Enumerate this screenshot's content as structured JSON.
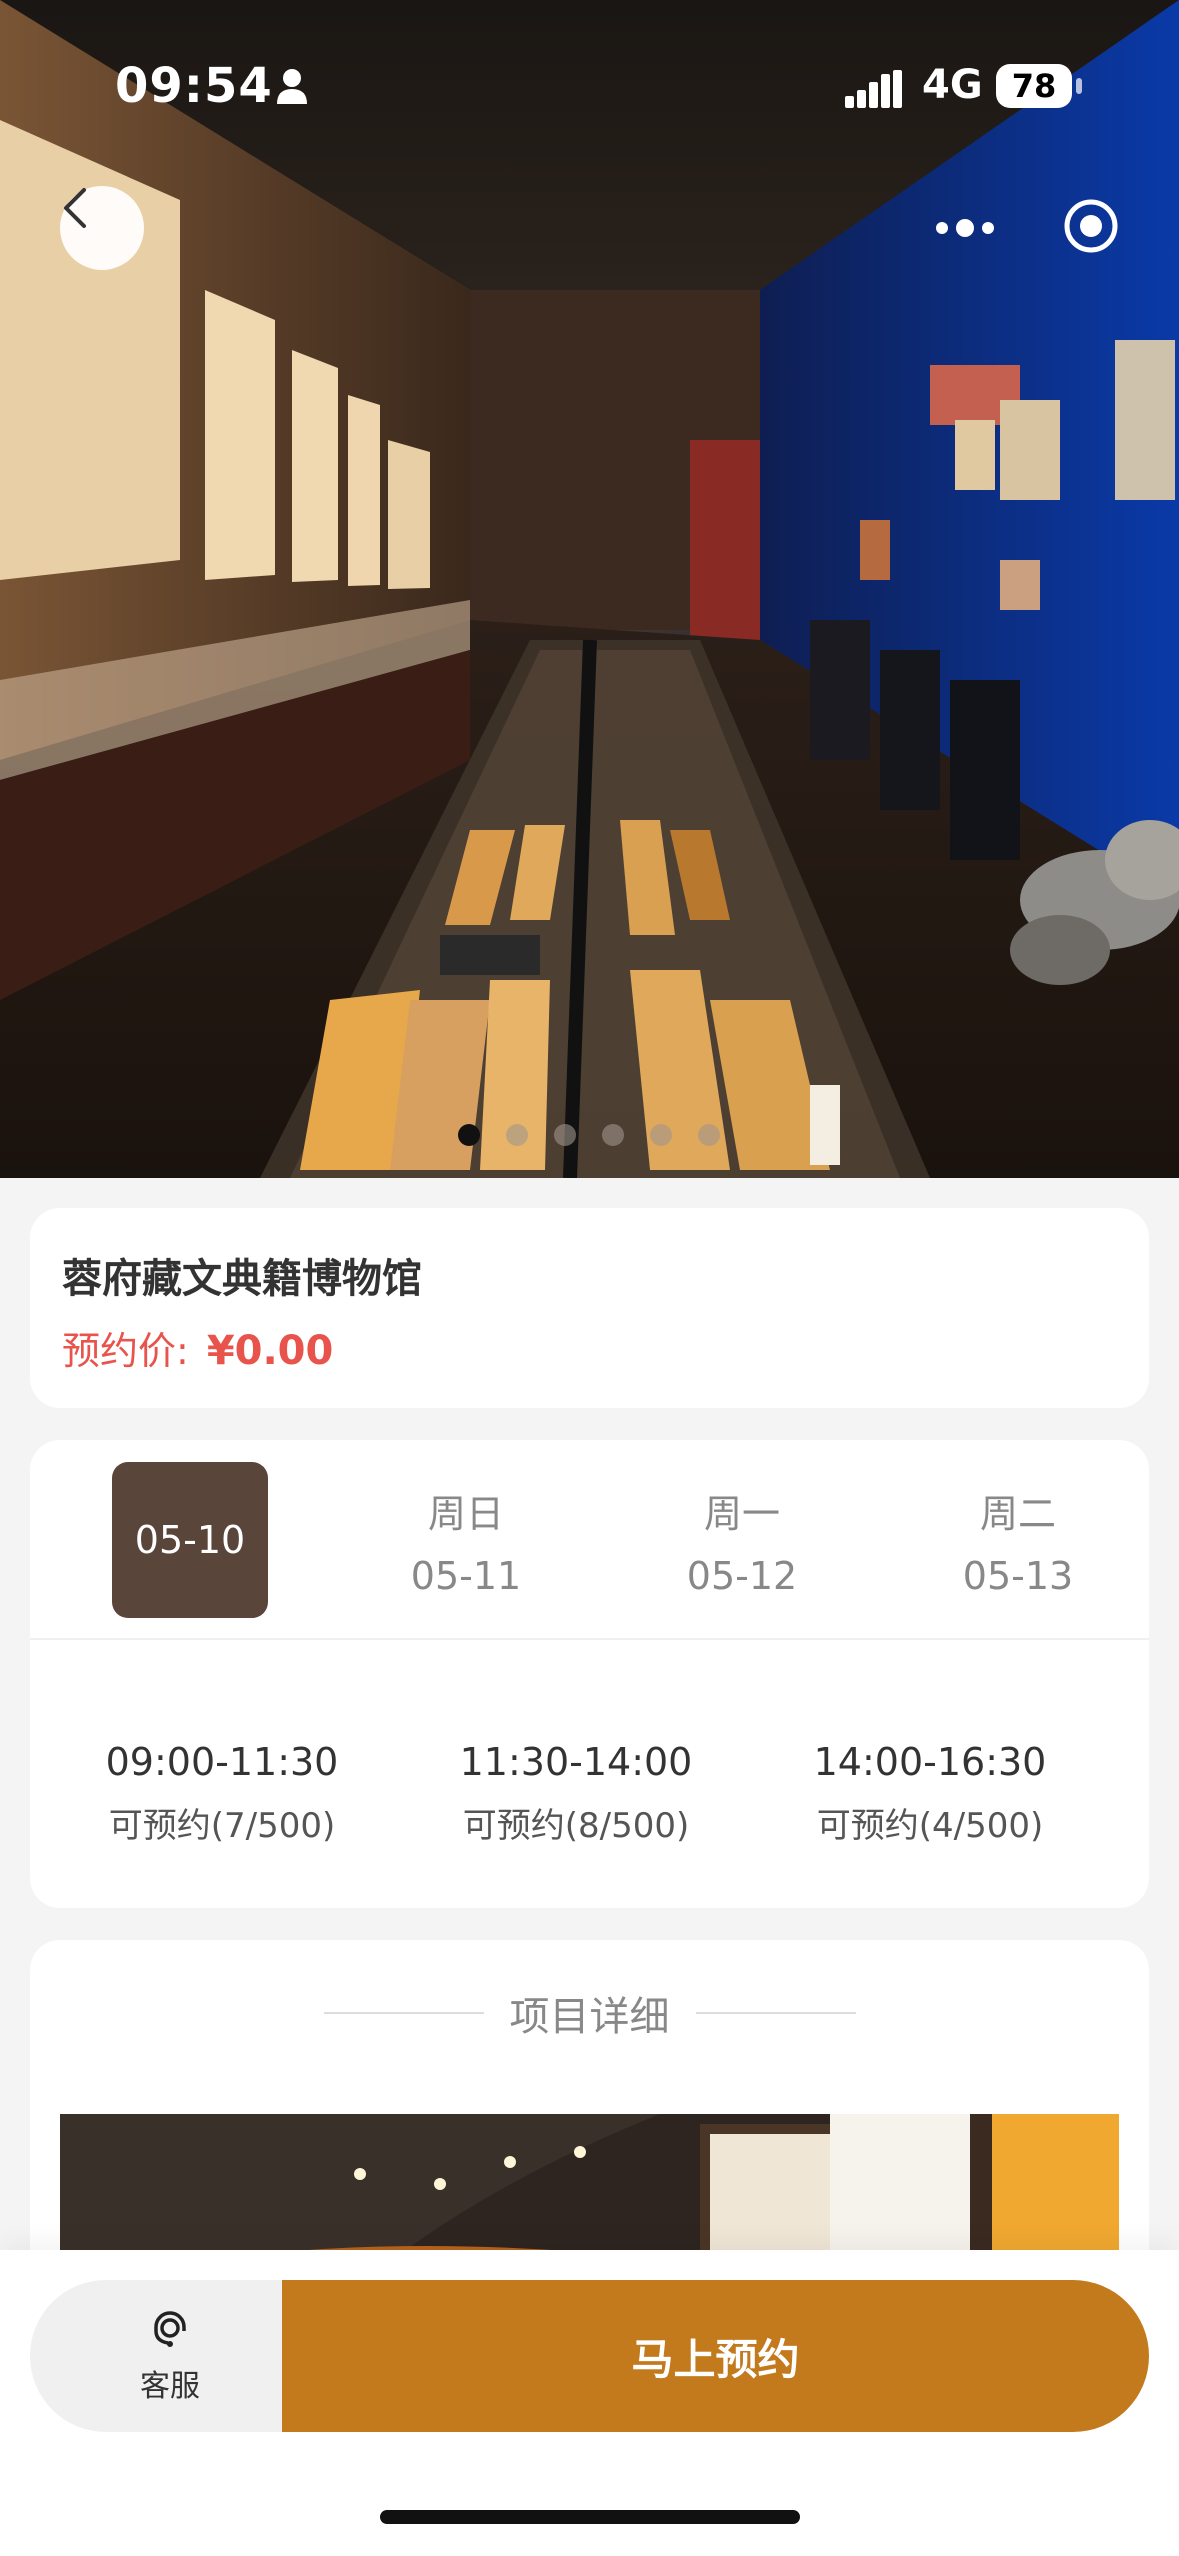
{
  "status_bar": {
    "time": "09:54",
    "network": "4G",
    "battery": "78"
  },
  "hero": {
    "slide_count": 6,
    "active_index": 0
  },
  "museum": {
    "name": "蓉府藏文典籍博物馆",
    "price_label": "预约价:",
    "price_value": "¥0.00"
  },
  "dates": [
    {
      "weekday": "",
      "date": "05-10",
      "selected": true
    },
    {
      "weekday": "周日",
      "date": "05-11",
      "selected": false
    },
    {
      "weekday": "周一",
      "date": "05-12",
      "selected": false
    },
    {
      "weekday": "周二",
      "date": "05-13",
      "selected": false
    }
  ],
  "slots": [
    {
      "time": "09:00-11:30",
      "availability": "可预约(7/500)"
    },
    {
      "time": "11:30-14:00",
      "availability": "可预约(8/500)"
    },
    {
      "time": "14:00-16:30",
      "availability": "可预约(4/500)"
    }
  ],
  "detail": {
    "title": "项目详细"
  },
  "bottom": {
    "service_label": "客服",
    "book_label": "马上预约"
  },
  "icons": {
    "back": "chevron-left-icon",
    "more": "more-dots-icon",
    "target": "target-circle-icon",
    "service": "headset-icon"
  },
  "colors": {
    "accent": "#c27a1c",
    "selected_date": "#5a453a",
    "price": "#e8544c"
  }
}
